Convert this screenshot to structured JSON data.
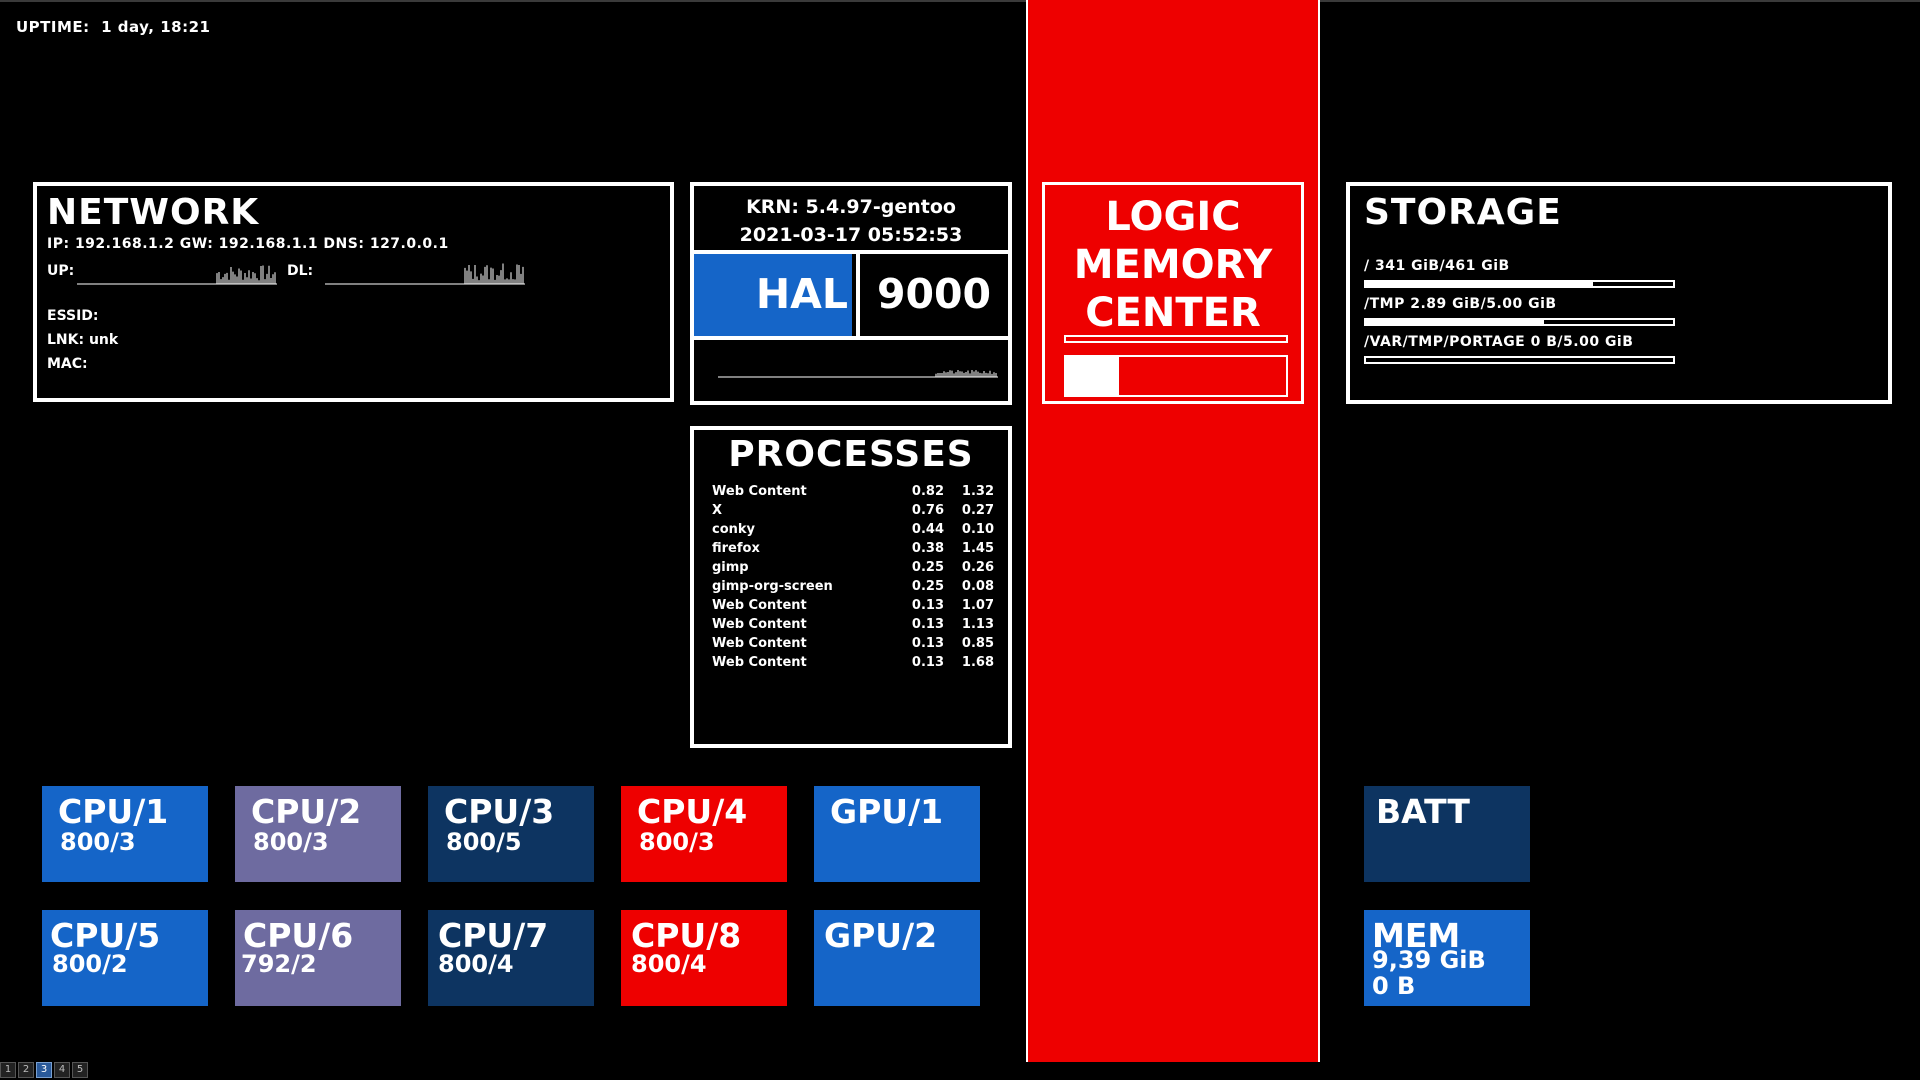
{
  "uptime": {
    "label": "UPTIME:",
    "value": "1 day, 18:21"
  },
  "network": {
    "title": "NETWORK",
    "ip_line": "IP: 192.168.1.2 GW: 192.168.1.1 DNS: 127.0.0.1",
    "up_label": "UP:",
    "dl_label": "DL:",
    "essid_label": "ESSID:",
    "link_label": "LNK: unk",
    "mac_label": "MAC:"
  },
  "kernel": {
    "krn": "KRN: 5.4.97-gentoo",
    "datetime": "2021-03-17 05:52:53",
    "hal_left": "HAL",
    "hal_right": "9000"
  },
  "processes": {
    "title": "PROCESSES",
    "rows": [
      {
        "name": "Web Content",
        "cpu": "0.82",
        "mem": "1.32"
      },
      {
        "name": "X",
        "cpu": "0.76",
        "mem": "0.27"
      },
      {
        "name": "conky",
        "cpu": "0.44",
        "mem": "0.10"
      },
      {
        "name": "firefox",
        "cpu": "0.38",
        "mem": "1.45"
      },
      {
        "name": "gimp",
        "cpu": "0.25",
        "mem": "0.26"
      },
      {
        "name": "gimp-org-screen",
        "cpu": "0.25",
        "mem": "0.08"
      },
      {
        "name": "Web Content",
        "cpu": "0.13",
        "mem": "1.07"
      },
      {
        "name": "Web Content",
        "cpu": "0.13",
        "mem": "1.13"
      },
      {
        "name": "Web Content",
        "cpu": "0.13",
        "mem": "0.85"
      },
      {
        "name": "Web Content",
        "cpu": "0.13",
        "mem": "1.68"
      }
    ]
  },
  "logic_memory": {
    "title_line1": "LOGIC",
    "title_line2": "MEMORY",
    "title_line3": "CENTER",
    "bar1_level": 0,
    "bar2_level": 0.24
  },
  "storage": {
    "title": "STORAGE",
    "mounts": [
      {
        "text": "/ 341 GiB/461 GiB",
        "level": 0.74
      },
      {
        "text": "/TMP 2.89 GiB/5.00 GiB",
        "level": 0.58
      },
      {
        "text": "/VAR/TMP/PORTAGE 0 B/5.00 GiB",
        "level": 0
      }
    ]
  },
  "tiles": {
    "cpu1": {
      "name": "CPU/1",
      "value": "800/3",
      "color": "#1565c8"
    },
    "cpu2": {
      "name": "CPU/2",
      "value": "800/3",
      "color": "#6e6ba0"
    },
    "cpu3": {
      "name": "CPU/3",
      "value": "800/5",
      "color": "#0d3461"
    },
    "cpu4": {
      "name": "CPU/4",
      "value": "800/3",
      "color": "#ee0000"
    },
    "gpu1": {
      "name": "GPU/1",
      "value": "",
      "color": "#1565c8"
    },
    "cpu5": {
      "name": "CPU/5",
      "value": "800/2",
      "color": "#1565c8"
    },
    "cpu6": {
      "name": "CPU/6",
      "value": "792/2",
      "color": "#6e6ba0"
    },
    "cpu7": {
      "name": "CPU/7",
      "value": "800/4",
      "color": "#0d3461"
    },
    "cpu8": {
      "name": "CPU/8",
      "value": "800/4",
      "color": "#ee0000"
    },
    "gpu2": {
      "name": "GPU/2",
      "value": "",
      "color": "#1565c8"
    },
    "batt": {
      "name": "BATT",
      "value": "",
      "color": "#0d3461"
    },
    "mem": {
      "name": "MEM",
      "value": "9,39 GiB",
      "value2": "0 B",
      "color": "#1565c8"
    }
  },
  "workspaces": {
    "items": [
      "1",
      "2",
      "3",
      "4",
      "5"
    ],
    "active": "3"
  },
  "colors": {
    "background": "#000000",
    "accent_red": "#ee0000",
    "accent_blue": "#1565c8",
    "dark_blue": "#0d3461",
    "purple": "#6e6ba0"
  }
}
